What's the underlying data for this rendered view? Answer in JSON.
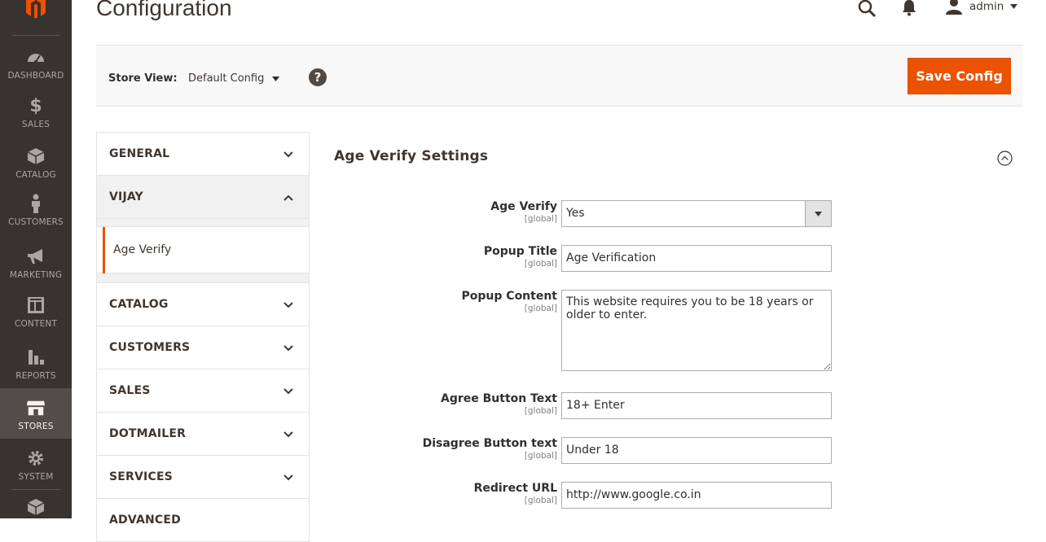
{
  "page": {
    "title": "Configuration"
  },
  "header": {
    "user_name": "admin"
  },
  "nav": [
    {
      "label": "DASHBOARD",
      "icon": "dashboard-icon"
    },
    {
      "label": "SALES",
      "icon": "dollar-icon"
    },
    {
      "label": "CATALOG",
      "icon": "box-icon"
    },
    {
      "label": "CUSTOMERS",
      "icon": "person-icon"
    },
    {
      "label": "MARKETING",
      "icon": "megaphone-icon"
    },
    {
      "label": "CONTENT",
      "icon": "layout-icon"
    },
    {
      "label": "REPORTS",
      "icon": "bar-chart-icon"
    },
    {
      "label": "STORES",
      "icon": "store-icon",
      "active": true
    },
    {
      "label": "SYSTEM",
      "icon": "gear-icon"
    }
  ],
  "toolbar": {
    "store_view_label": "Store View:",
    "store_view_value": "Default Config",
    "help": "?",
    "save_label": "Save Config"
  },
  "tabs": [
    {
      "label": "GENERAL"
    },
    {
      "label": "VIJAY",
      "open": true,
      "items": [
        {
          "label": "Age Verify",
          "active": true
        }
      ]
    },
    {
      "label": "CATALOG"
    },
    {
      "label": "CUSTOMERS"
    },
    {
      "label": "SALES"
    },
    {
      "label": "DOTMAILER"
    },
    {
      "label": "SERVICES"
    },
    {
      "label": "ADVANCED"
    }
  ],
  "section": {
    "title": "Age Verify Settings",
    "fields": [
      {
        "label": "Age Verify",
        "scope": "[global]",
        "type": "select",
        "value": "Yes"
      },
      {
        "label": "Popup Title",
        "scope": "[global]",
        "type": "text",
        "value": "Age Verification"
      },
      {
        "label": "Popup Content",
        "scope": "[global]",
        "type": "textarea",
        "value": "This website requires you to be 18 years or older to enter."
      },
      {
        "label": "Agree Button Text",
        "scope": "[global]",
        "type": "text",
        "value": "18+ Enter"
      },
      {
        "label": "Disagree Button text",
        "scope": "[global]",
        "type": "text",
        "value": "Under 18"
      },
      {
        "label": "Redirect URL",
        "scope": "[global]",
        "type": "text",
        "value": "http://www.google.co.in"
      }
    ]
  },
  "colors": {
    "sidebar": "#373330",
    "accent": "#eb5202",
    "active_nav": "#524d49"
  }
}
